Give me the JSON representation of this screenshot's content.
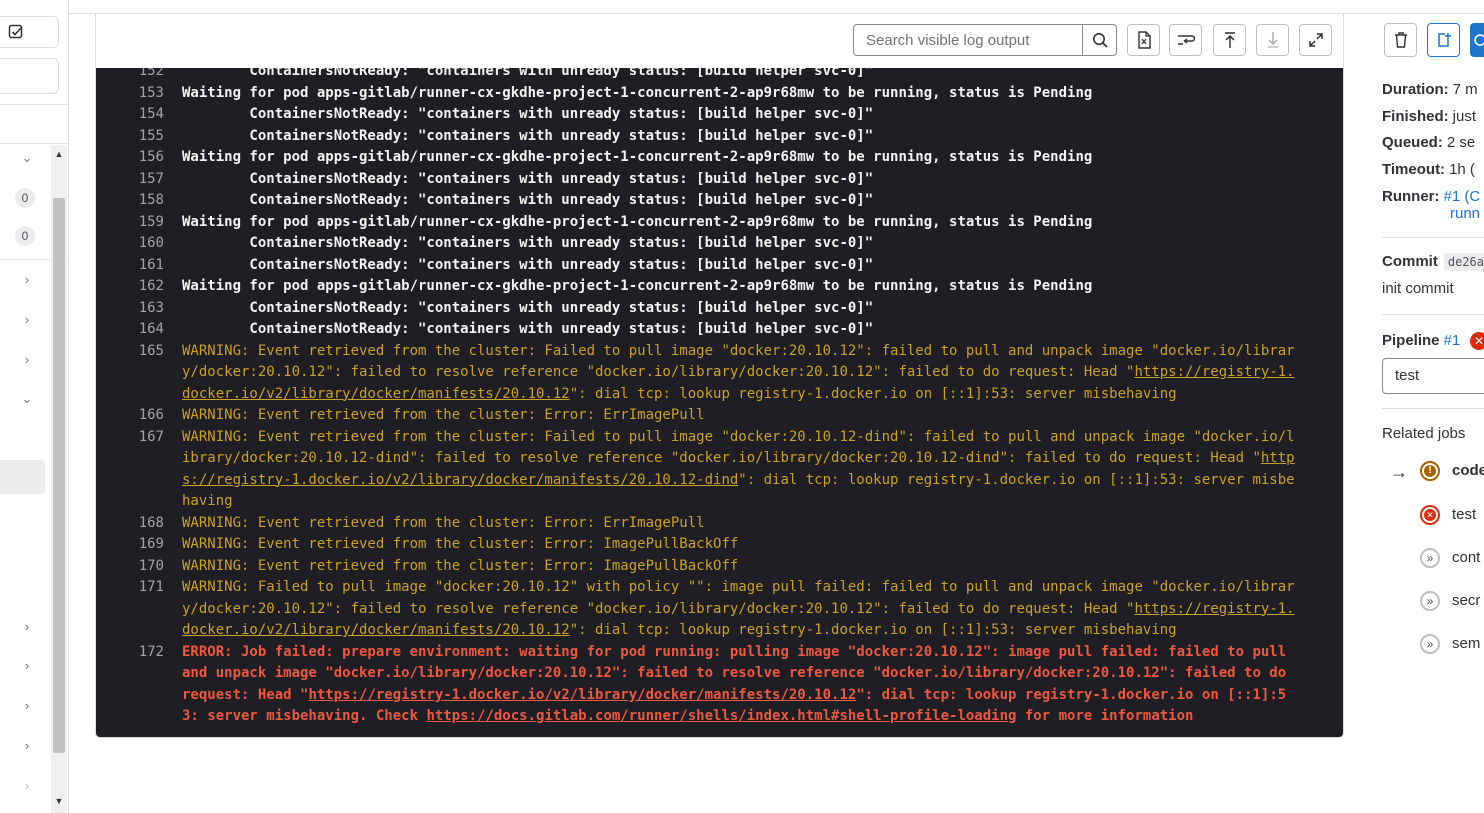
{
  "sidebar": {
    "badges": [
      "0",
      "0"
    ]
  },
  "toolbar": {
    "search_placeholder": "Search visible log output"
  },
  "log": {
    "lines": [
      {
        "n": "152",
        "kind": "norm",
        "segments": [
          {
            "t": "        ContainersNotReady: \"containers with unready status: [build helper svc-0]\""
          }
        ]
      },
      {
        "n": "153",
        "kind": "norm",
        "segments": [
          {
            "t": "Waiting for pod apps-gitlab/runner-cx-gkdhe-project-1-concurrent-2-ap9r68mw to be running, status is Pending"
          }
        ]
      },
      {
        "n": "154",
        "kind": "norm",
        "segments": [
          {
            "t": "        ContainersNotReady: \"containers with unready status: [build helper svc-0]\""
          }
        ]
      },
      {
        "n": "155",
        "kind": "norm",
        "segments": [
          {
            "t": "        ContainersNotReady: \"containers with unready status: [build helper svc-0]\""
          }
        ]
      },
      {
        "n": "156",
        "kind": "norm",
        "segments": [
          {
            "t": "Waiting for pod apps-gitlab/runner-cx-gkdhe-project-1-concurrent-2-ap9r68mw to be running, status is Pending"
          }
        ]
      },
      {
        "n": "157",
        "kind": "norm",
        "segments": [
          {
            "t": "        ContainersNotReady: \"containers with unready status: [build helper svc-0]\""
          }
        ]
      },
      {
        "n": "158",
        "kind": "norm",
        "segments": [
          {
            "t": "        ContainersNotReady: \"containers with unready status: [build helper svc-0]\""
          }
        ]
      },
      {
        "n": "159",
        "kind": "norm",
        "segments": [
          {
            "t": "Waiting for pod apps-gitlab/runner-cx-gkdhe-project-1-concurrent-2-ap9r68mw to be running, status is Pending"
          }
        ]
      },
      {
        "n": "160",
        "kind": "norm",
        "segments": [
          {
            "t": "        ContainersNotReady: \"containers with unready status: [build helper svc-0]\""
          }
        ]
      },
      {
        "n": "161",
        "kind": "norm",
        "segments": [
          {
            "t": "        ContainersNotReady: \"containers with unready status: [build helper svc-0]\""
          }
        ]
      },
      {
        "n": "162",
        "kind": "norm",
        "segments": [
          {
            "t": "Waiting for pod apps-gitlab/runner-cx-gkdhe-project-1-concurrent-2-ap9r68mw to be running, status is Pending"
          }
        ]
      },
      {
        "n": "163",
        "kind": "norm",
        "segments": [
          {
            "t": "        ContainersNotReady: \"containers with unready status: [build helper svc-0]\""
          }
        ]
      },
      {
        "n": "164",
        "kind": "norm",
        "segments": [
          {
            "t": "        ContainersNotReady: \"containers with unready status: [build helper svc-0]\""
          }
        ]
      },
      {
        "n": "165",
        "kind": "warn",
        "rows": 3,
        "segments": [
          {
            "t": "WARNING: Event retrieved from the cluster: Failed to pull image \"docker:20.10.12\": failed to pull and unpack image \"docker.io/librar\ny/docker:20.10.12\": failed to resolve reference \"docker.io/library/docker:20.10.12\": failed to do request: Head \""
          },
          {
            "t": "https://registry-1.\ndocker.io/v2/library/docker/manifests/20.10.12",
            "link": true
          },
          {
            "t": "\": dial tcp: lookup registry-1.docker.io on [::1]:53: server misbehaving"
          }
        ]
      },
      {
        "n": "166",
        "kind": "warn",
        "segments": [
          {
            "t": "WARNING: Event retrieved from the cluster: Error: ErrImagePull"
          }
        ]
      },
      {
        "n": "167",
        "kind": "warn",
        "rows": 4,
        "segments": [
          {
            "t": "WARNING: Event retrieved from the cluster: Failed to pull image \"docker:20.10.12-dind\": failed to pull and unpack image \"docker.io/l\nibrary/docker:20.10.12-dind\": failed to resolve reference \"docker.io/library/docker:20.10.12-dind\": failed to do request: Head \""
          },
          {
            "t": "http\ns://registry-1.docker.io/v2/library/docker/manifests/20.10.12-dind",
            "link": true
          },
          {
            "t": "\": dial tcp: lookup registry-1.docker.io on [::1]:53: server misbe\nhaving"
          }
        ]
      },
      {
        "n": "168",
        "kind": "warn",
        "segments": [
          {
            "t": "WARNING: Event retrieved from the cluster: Error: ErrImagePull"
          }
        ]
      },
      {
        "n": "169",
        "kind": "warn",
        "segments": [
          {
            "t": "WARNING: Event retrieved from the cluster: Error: ImagePullBackOff"
          }
        ]
      },
      {
        "n": "170",
        "kind": "warn",
        "segments": [
          {
            "t": "WARNING: Event retrieved from the cluster: Error: ImagePullBackOff"
          }
        ]
      },
      {
        "n": "171",
        "kind": "warn",
        "rows": 3,
        "segments": [
          {
            "t": "WARNING: Failed to pull image \"docker:20.10.12\" with policy \"\": image pull failed: failed to pull and unpack image \"docker.io/librar\ny/docker:20.10.12\": failed to resolve reference \"docker.io/library/docker:20.10.12\": failed to do request: Head \""
          },
          {
            "t": "https://registry-1.\ndocker.io/v2/library/docker/manifests/20.10.12",
            "link": true
          },
          {
            "t": "\": dial tcp: lookup registry-1.docker.io on [::1]:53: server misbehaving"
          }
        ]
      },
      {
        "n": "172",
        "kind": "err",
        "rows": 4,
        "segments": [
          {
            "t": "ERROR: Job failed: prepare environment: waiting for pod running: pulling image \"docker:20.10.12\": image pull failed: failed to pull\nand unpack image \"docker.io/library/docker:20.10.12\": failed to resolve reference \"docker.io/library/docker:20.10.12\": failed to do\nrequest: Head \""
          },
          {
            "t": "https://registry-1.docker.io/v2/library/docker/manifests/20.10.12",
            "link": true
          },
          {
            "t": "\": dial tcp: lookup registry-1.docker.io on [::1]:5\n3: server misbehaving. Check "
          },
          {
            "t": "https://docs.gitlab.com/runner/shells/index.html#shell-profile-loading",
            "link": true
          },
          {
            "t": " for more information"
          }
        ]
      }
    ]
  },
  "details": {
    "duration_label": "Duration:",
    "duration_value": "7 m",
    "finished_label": "Finished:",
    "finished_value": "just",
    "queued_label": "Queued:",
    "queued_value": "2 se",
    "timeout_label": "Timeout:",
    "timeout_value": "1h (",
    "runner_label": "Runner:",
    "runner_value": "#1 (C",
    "runner_value2": "runn",
    "commit_label": "Commit",
    "commit_sha": "de26a",
    "commit_title": "init commit",
    "pipeline_label": "Pipeline",
    "pipeline_link": "#1",
    "stage_select": "test",
    "related_jobs_label": "Related jobs",
    "jobs": [
      {
        "name": "code",
        "status": "warning",
        "current": true
      },
      {
        "name": "test",
        "status": "failed",
        "current": false
      },
      {
        "name": "cont",
        "status": "skipped",
        "current": false
      },
      {
        "name": "secr",
        "status": "skipped",
        "current": false
      },
      {
        "name": "sem",
        "status": "skipped",
        "current": false
      }
    ]
  },
  "colors": {
    "log_bg": "#1f1e24",
    "warning_text": "#c9a227",
    "error_text": "#ec5941",
    "link_blue": "#1f75cb",
    "failed_red": "#dd2b0e",
    "warning_orange": "#ab6100"
  }
}
